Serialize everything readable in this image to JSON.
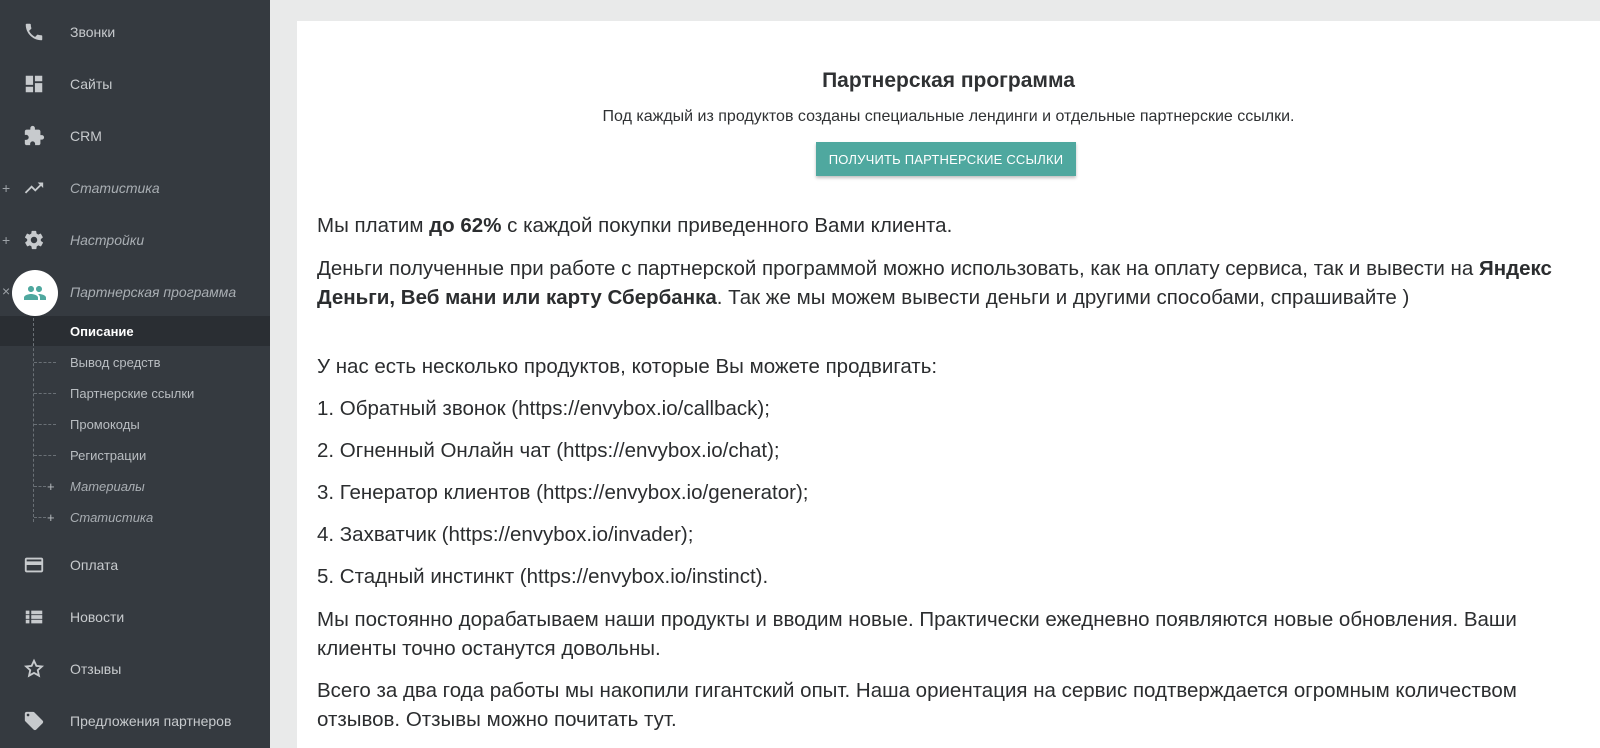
{
  "sidebar": {
    "items": [
      {
        "label": "Звонки",
        "icon": "phone-icon"
      },
      {
        "label": "Сайты",
        "icon": "dashboard-icon"
      },
      {
        "label": "CRM",
        "icon": "puzzle-icon"
      },
      {
        "label": "Статистика",
        "icon": "trending-up-icon",
        "prefix": "+"
      },
      {
        "label": "Настройки",
        "icon": "gear-icon",
        "prefix": "+"
      },
      {
        "label": "Партнерская программа",
        "icon": "people-icon",
        "prefix": "×"
      },
      {
        "label": "Оплата",
        "icon": "credit-card-icon"
      },
      {
        "label": "Новости",
        "icon": "list-icon"
      },
      {
        "label": "Отзывы",
        "icon": "star-icon"
      },
      {
        "label": "Предложения партнеров",
        "icon": "tag-icon"
      }
    ],
    "subitems": [
      {
        "label": "Описание"
      },
      {
        "label": "Вывод средств"
      },
      {
        "label": "Партнерские ссылки"
      },
      {
        "label": "Промокоды"
      },
      {
        "label": "Регистрации"
      },
      {
        "label": "Материалы",
        "prefix": "+"
      },
      {
        "label": "Статистика",
        "prefix": "+"
      }
    ]
  },
  "main": {
    "title": "Партнерская программа",
    "subtitle": "Под каждый из продуктов созданы специальные лендинги и отдельные партнерские ссылки.",
    "cta_label": "ПОЛУЧИТЬ ПАРТНЕРСКИЕ ССЫЛКИ",
    "p1": {
      "a": "Мы платим ",
      "b": "до 62%",
      "c": " с каждой покупки приведенного Вами клиента."
    },
    "p2": {
      "a": "Деньги полученные при работе с партнерской программой можно использовать, как на оплату сервиса, так и вывести на ",
      "b": "Яндекс Деньги, Веб мани или карту Сбербанка",
      "c": ". Так же мы можем вывести деньги и другими способами, спрашивайте )"
    },
    "p3": "У нас есть несколько продуктов, которые Вы можете продвигать:",
    "products": [
      "1. Обратный звонок (https://envybox.io/callback);",
      "2. Огненный Онлайн чат (https://envybox.io/chat);",
      "3. Генератор клиентов (https://envybox.io/generator);",
      "4. Захватчик (https://envybox.io/invader);",
      "5. Стадный инстинкт (https://envybox.io/instinct)."
    ],
    "p4": "Мы постоянно дорабатываем наши продукты и вводим новые. Практически ежедневно появляются новые обновления. Ваши клиенты точно останутся довольны.",
    "p5": "Всего за два года работы мы накопили гигантский опыт. Наша ориентация на сервис подтверждается огромным количеством отзывов. Отзывы можно почитать тут."
  },
  "colors": {
    "sidebar_bg": "#353a40",
    "accent": "#4fa89f",
    "page_bg": "#e9eaea"
  }
}
